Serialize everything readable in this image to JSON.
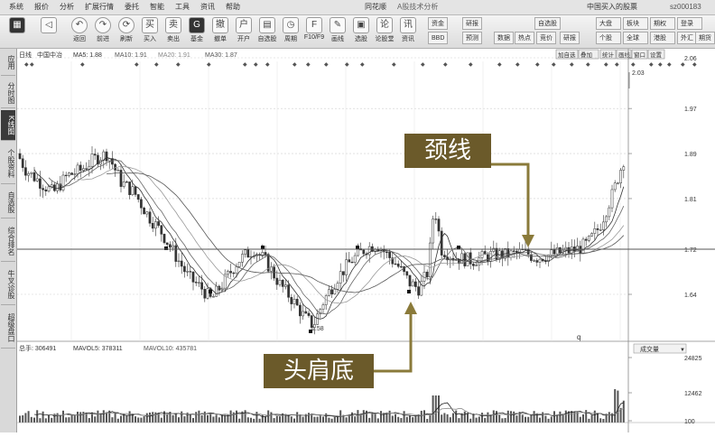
{
  "menubar": {
    "items": [
      "系统",
      "报价",
      "分析",
      "扩展行情",
      "委托",
      "智能",
      "工具",
      "资讯",
      "帮助"
    ],
    "app_title": "同花顺",
    "app_sub": "A股技术分析",
    "right_text": "中国买入的股票",
    "right_code": "sz000183"
  },
  "toolbar": {
    "buttons": [
      {
        "label": "",
        "icon": "window-icon"
      },
      {
        "label": "",
        "icon": "back-icon"
      },
      {
        "label": "返回",
        "icon": "return-icon"
      },
      {
        "label": "前进",
        "icon": "forward-icon"
      },
      {
        "label": "刷新",
        "icon": "refresh-icon"
      },
      {
        "label": "买入",
        "icon": "buy-icon"
      },
      {
        "label": "卖出",
        "icon": "sell-icon"
      },
      {
        "label": "基金",
        "icon": "fund-icon"
      },
      {
        "label": "撤单",
        "icon": "cancel-order-icon"
      },
      {
        "label": "开户",
        "icon": "open-account-icon"
      },
      {
        "label": "自选股",
        "icon": "watchlist-icon"
      },
      {
        "label": "周期",
        "icon": "period-icon"
      },
      {
        "label": "F10/F9",
        "icon": "f10-icon"
      },
      {
        "label": "画线",
        "icon": "draw-line-icon"
      },
      {
        "label": "选股",
        "icon": "stock-picker-icon"
      },
      {
        "label": "论股堂",
        "icon": "forum-icon"
      },
      {
        "label": "资讯",
        "icon": "news-icon"
      }
    ],
    "small_buttons": [
      "资金",
      "BBD",
      "研报",
      "预测",
      "数据",
      "热点",
      "自选股",
      "竞价",
      "研报"
    ],
    "right_buttons": [
      "大盘",
      "板块",
      "个股",
      "全球",
      "期权",
      "登录",
      "港股",
      "外汇",
      "期货"
    ],
    "sub_tabs": [
      "加自选",
      "叠加",
      "统计",
      "画线",
      "窗口",
      "设置"
    ]
  },
  "sidebar": {
    "items": [
      "应用",
      "分时图",
      "K线图",
      "个股资料",
      "自选股",
      "综合排名",
      "牛叉诊股",
      "超级盘口"
    ],
    "active_index": 2
  },
  "chart": {
    "legend_prefix": "日线",
    "stock_name": "中国中冶",
    "ma": [
      {
        "label": "MA5: 1.88",
        "color": "#333333"
      },
      {
        "label": "MA10: 1.91",
        "color": "#666666"
      },
      {
        "label": "MA20: 1.91",
        "color": "#999999"
      },
      {
        "label": "MA30: 1.87",
        "color": "#555555"
      }
    ],
    "price_ticks": [
      "2.06",
      "1.97",
      "1.89",
      "1.81",
      "1.72",
      "1.64"
    ],
    "high_label": "2.03",
    "low_label": "1.58",
    "q_label": "q",
    "volume_legend": {
      "total": "总手: 306491",
      "mavol5": "MAVOL5: 378311",
      "mavol10": "MAVOL10: 435781"
    },
    "volume_selector": "成交量",
    "volume_ticks": [
      "24825",
      "12462",
      "100"
    ]
  },
  "annotations": {
    "neckline": "颈线",
    "head_shoulders_bottom": "头肩底"
  },
  "colors": {
    "callout_bg": "#6b5a2a",
    "arrow": "#8a7a3a",
    "candle": "#333333",
    "grid": "#c8c8c8"
  }
}
